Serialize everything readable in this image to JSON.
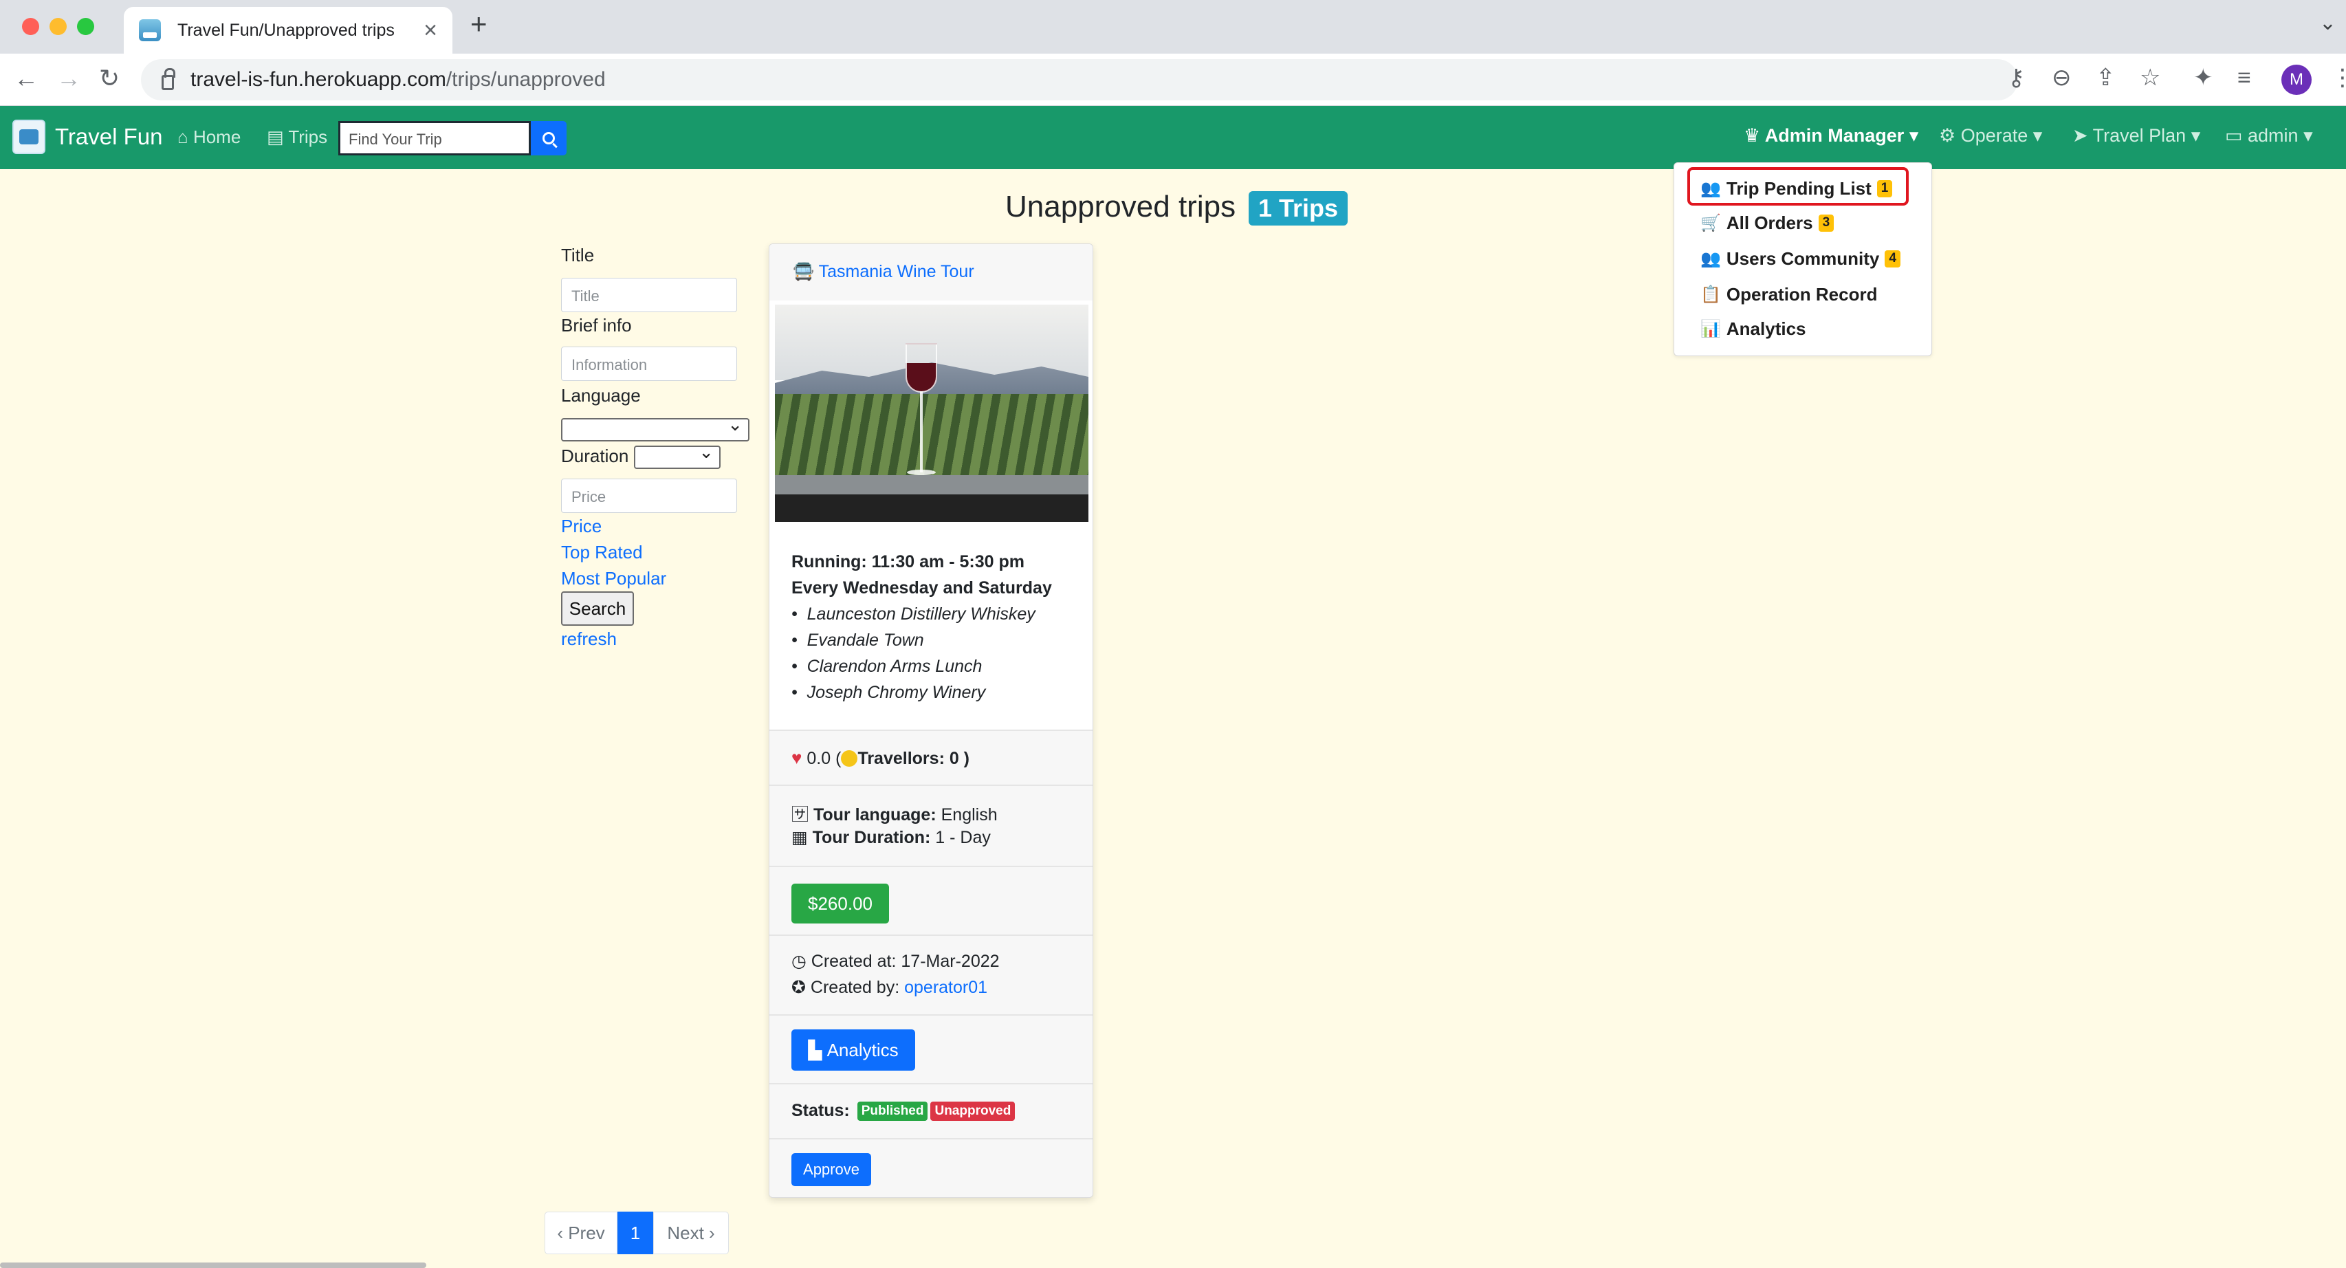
{
  "browser": {
    "tab_title": "Travel Fun/Unapproved trips",
    "url_host": "travel-is-fun.herokuapp.com",
    "url_path": "/trips/unapproved",
    "profile_initial": "M"
  },
  "navbar": {
    "brand": "Travel Fun",
    "home": "Home",
    "trips": "Trips",
    "search_placeholder": "Find Your Trip",
    "admin_manager": "Admin Manager",
    "operate": "Operate",
    "travel_plan": "Travel Plan",
    "admin": "admin"
  },
  "dropdown": {
    "items": [
      {
        "label": "Trip Pending List",
        "badge": "1",
        "icon": "users-icon"
      },
      {
        "label": "All Orders",
        "badge": "3",
        "icon": "cart-icon"
      },
      {
        "label": "Users Community",
        "badge": "4",
        "icon": "users-icon"
      },
      {
        "label": "Operation Record",
        "badge": "",
        "icon": "clipboard-icon"
      },
      {
        "label": "Analytics",
        "badge": "",
        "icon": "chart-icon"
      }
    ]
  },
  "page": {
    "title": "Unapproved trips",
    "count_badge": "1 Trips"
  },
  "filters": {
    "title_label": "Title",
    "title_placeholder": "Title",
    "brief_label": "Brief info",
    "brief_placeholder": "Information",
    "language_label": "Language",
    "duration_label": "Duration",
    "price_placeholder": "Price",
    "sort_price": "Price",
    "sort_top_rated": "Top Rated",
    "sort_most_popular": "Most Popular",
    "search_button": "Search",
    "refresh": "refresh"
  },
  "trip": {
    "title": "Tasmania Wine Tour",
    "running": "Running: 11:30 am - 5:30 pm",
    "schedule": "Every Wednesday and Saturday",
    "stops": [
      "Launceston Distillery Whiskey",
      "Evandale Town",
      "Clarendon Arms Lunch",
      "Joseph Chromy Winery"
    ],
    "rating": "0.0",
    "travellors_label": "Travellors: 0 )",
    "language_label": "Tour language:",
    "language": "English",
    "duration_label": "Tour Duration:",
    "duration": "1 - Day",
    "price": "$260.00",
    "created_at_label": "Created at:",
    "created_at": "17-Mar-2022",
    "created_by_label": "Created by:",
    "created_by": "operator01",
    "analytics_button": "Analytics",
    "status_label": "Status:",
    "status_published": "Published",
    "status_unapproved": "Unapproved",
    "approve_button": "Approve"
  },
  "pagination": {
    "prev": "‹ Prev",
    "current": "1",
    "next": "Next ›"
  },
  "colors": {
    "navbar": "#18996a",
    "page_bg": "#fffbe6",
    "primary": "#0d6efd",
    "success": "#28a745",
    "danger": "#dc3545",
    "warning": "#ffc107",
    "info": "#21a4c4",
    "highlight": "#e0161f"
  }
}
